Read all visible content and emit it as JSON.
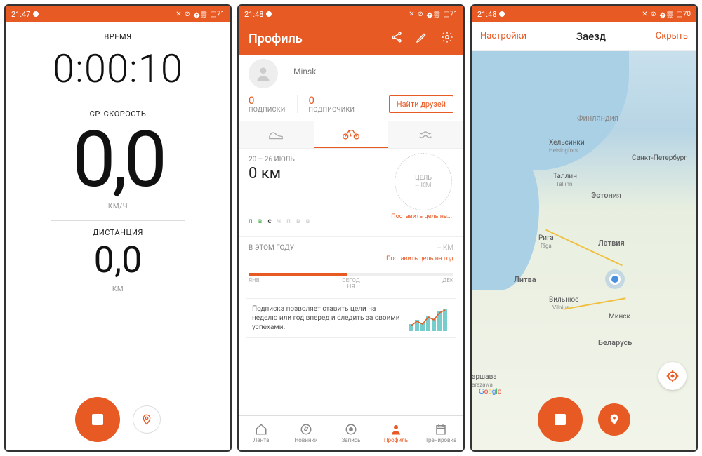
{
  "status": {
    "time1": "21:47",
    "time2": "21:48",
    "time3": "21:48",
    "battery1": "71",
    "battery2": "71",
    "battery3": "70"
  },
  "s1": {
    "time_label": "ВРЕМЯ",
    "time_value": "0:00:10",
    "speed_label": "СР. СКОРОСТЬ",
    "speed_value": "0,0",
    "speed_unit": "КМ/Ч",
    "dist_label": "ДИСТАНЦИЯ",
    "dist_value": "0,0",
    "dist_unit": "КМ"
  },
  "s2": {
    "header": "Профиль",
    "city": "Minsk",
    "subs_count": "0",
    "subs_label": "ПОДПИСКИ",
    "followers_count": "0",
    "followers_label": "ПОДПИСЧИКИ",
    "find_friends": "Найти друзей",
    "date_range": "20 – 26 ИЮЛЬ",
    "week_km": "0 км",
    "goal_label": "ЦЕЛЬ",
    "goal_value": "-- КМ",
    "set_week_goal": "Поставить цель на...",
    "days": [
      "п",
      "в",
      "с",
      "ч",
      "п",
      "в",
      "в"
    ],
    "year_label": "В ЭТОМ ГОДУ",
    "year_km": "-- КМ",
    "set_year_goal": "Поставить цель на год",
    "timeline_start": "ЯНВ",
    "timeline_mid": "СЕГОД\nНЯ",
    "timeline_end": "ДЕК",
    "promo": "Подписка позволяет ставить цели на неделю или год вперед и следить за своими успехами.",
    "nav": [
      "Лента",
      "Новинки",
      "Запись",
      "Профиль",
      "Тренировка"
    ]
  },
  "s3": {
    "left": "Настройки",
    "title": "Заезд",
    "right": "Скрыть",
    "labels": {
      "finland": "Финляндия",
      "helsinki1": "Хельсинки",
      "helsinki2": "Helsingfors",
      "spb": "Санкт-Петербург",
      "tallinn": "Таллин",
      "tallinn2": "Tallinn",
      "estonia": "Эстония",
      "riga": "Рига",
      "riga2": "Rīga",
      "latvia": "Латвия",
      "lithuania": "Литва",
      "vilnius": "Вильнюс",
      "vilnius2": "Vilnius",
      "minsk": "Минск",
      "belarus": "Беларусь",
      "warsaw": "аршава",
      "warsaw2": "arszawa"
    }
  }
}
